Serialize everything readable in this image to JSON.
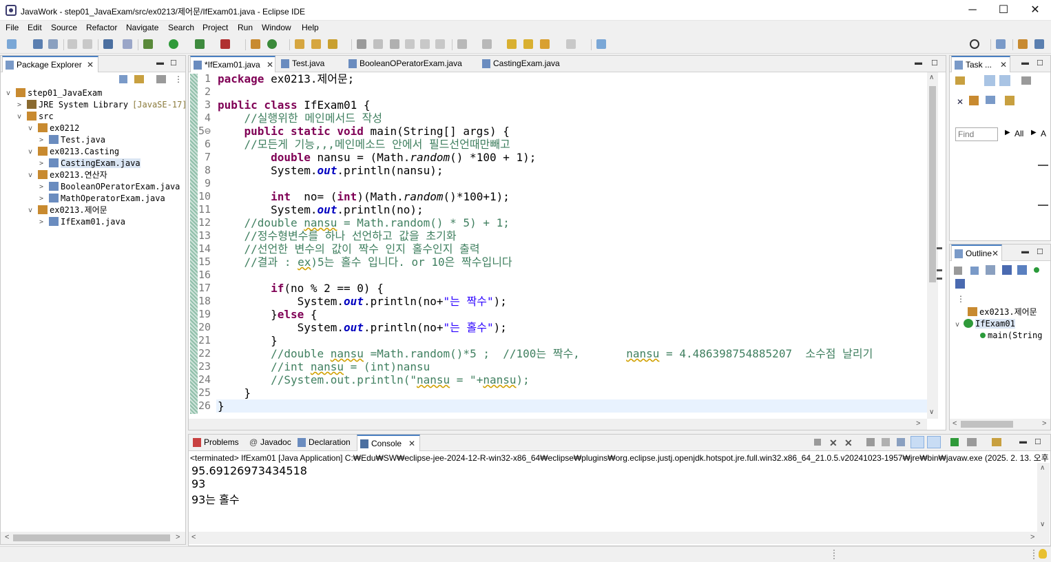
{
  "window": {
    "title": "JavaWork - step01_JavaExam/src/ex0213/제어문/IfExam01.java - Eclipse IDE",
    "minimize": "─",
    "maximize": "☐",
    "close": "✕"
  },
  "menu": [
    "File",
    "Edit",
    "Source",
    "Refactor",
    "Navigate",
    "Search",
    "Project",
    "Run",
    "Window",
    "Help"
  ],
  "package_explorer": {
    "tab_label": "Package Explorer",
    "tree": [
      {
        "label": "step01_JavaExam",
        "depth": 0,
        "twisty": "v"
      },
      {
        "label": "JRE System Library",
        "suffix": "[JavaSE-17]",
        "depth": 1,
        "twisty": ">"
      },
      {
        "label": "src",
        "depth": 1,
        "twisty": "v"
      },
      {
        "label": "ex0212",
        "depth": 2,
        "twisty": "v"
      },
      {
        "label": "Test.java",
        "depth": 3,
        "twisty": ">"
      },
      {
        "label": "ex0213.Casting",
        "depth": 2,
        "twisty": "v"
      },
      {
        "label": "CastingExam.java",
        "depth": 3,
        "twisty": ">",
        "selected": true
      },
      {
        "label": "ex0213.연산자",
        "depth": 2,
        "twisty": "v"
      },
      {
        "label": "BooleanOPeratorExam.java",
        "depth": 3,
        "twisty": ">"
      },
      {
        "label": "MathOperatorExam.java",
        "depth": 3,
        "twisty": ">"
      },
      {
        "label": "ex0213.제어문",
        "depth": 2,
        "twisty": "v"
      },
      {
        "label": "IfExam01.java",
        "depth": 3,
        "twisty": ">"
      }
    ]
  },
  "editor": {
    "tabs": [
      {
        "label": "*IfExam01.java",
        "active": true
      },
      {
        "label": "Test.java"
      },
      {
        "label": "BooleanOPeratorExam.java"
      },
      {
        "label": "CastingExam.java"
      }
    ],
    "current_line": 26
  },
  "task_panel": {
    "tab_label": "Task ...",
    "find_placeholder": "Find",
    "all_label": "All",
    "a_label": "A"
  },
  "outline": {
    "tab_label": "Outline",
    "items": [
      {
        "label": "ex0213.제어문"
      },
      {
        "label": "IfExam01"
      },
      {
        "label": "main(String"
      }
    ]
  },
  "bottom_tabs": [
    {
      "label": "Problems"
    },
    {
      "label": "Javadoc"
    },
    {
      "label": "Declaration"
    },
    {
      "label": "Console",
      "active": true
    }
  ],
  "console": {
    "header": "<terminated> IfExam01 [Java Application] C:₩Edu₩SW₩eclipse-jee-2024-12-R-win32-x86_64₩eclipse₩plugins₩org.eclipse.justj.openjdk.hotspot.jre.full.win32.x86_64_21.0.5.v20241023-1957₩jre₩bin₩javaw.exe  (2025. 2. 13. 오후",
    "output": [
      "95.69126973434518",
      "93",
      "93는 홀수"
    ]
  },
  "colors": {
    "keyword": "#7f0055",
    "comment": "#3f7f5f",
    "string": "#2a00ff",
    "field": "#0000c0",
    "active_tab_border": "#4a7fc1"
  }
}
